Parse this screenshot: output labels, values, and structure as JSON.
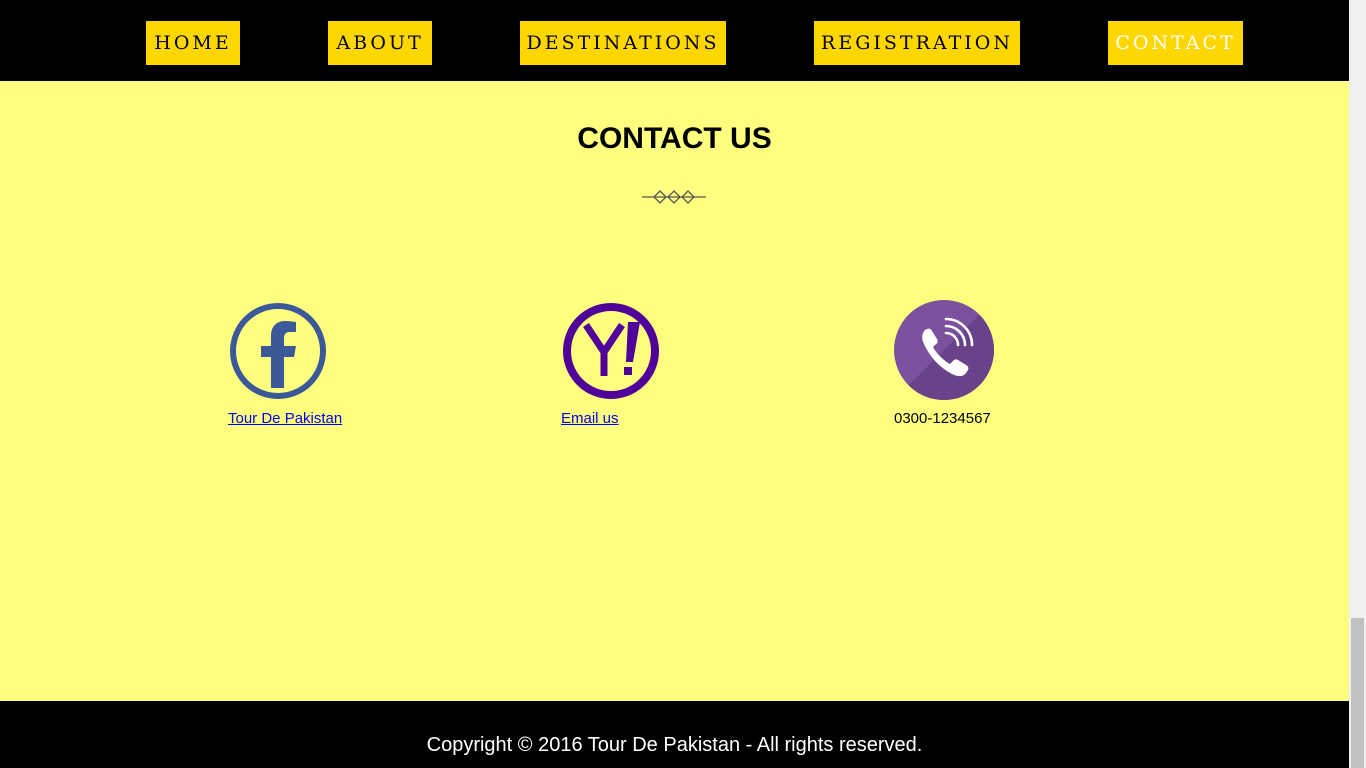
{
  "nav": {
    "items": [
      {
        "label": "HOME"
      },
      {
        "label": "ABOUT"
      },
      {
        "label": "DESTINATIONS"
      },
      {
        "label": "REGISTRATION"
      },
      {
        "label": "CONTACT",
        "active": true
      }
    ]
  },
  "page": {
    "title": "CONTACT US"
  },
  "contacts": [
    {
      "icon": "facebook-icon",
      "text": "Tour De Pakistan",
      "link": true
    },
    {
      "icon": "yahoo-icon",
      "text": "Email us",
      "link": true
    },
    {
      "icon": "viber-phone-icon",
      "text": "0300-1234567",
      "link": false
    }
  ],
  "footer": {
    "copyright": "Copyright © 2016 Tour De Pakistan - All rights reserved."
  },
  "colors": {
    "nav_background": "#000000",
    "nav_button": "#ffd700",
    "page_background": "#ffff7f",
    "facebook_blue": "#3b5998",
    "yahoo_purple": "#4f019a",
    "viber_purple": "#7b519d",
    "link": "#0000ee"
  }
}
